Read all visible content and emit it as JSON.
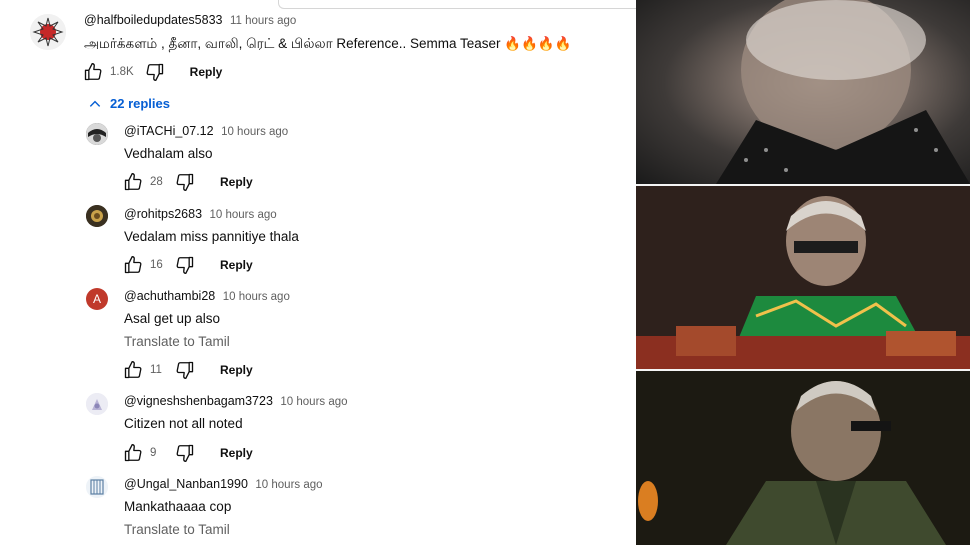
{
  "main_comment": {
    "author": "@halfboiledupdates5833",
    "time": "11 hours ago",
    "text": "அமர்க்களம் , தீனா, வாலி, ரெட் & பில்லா Reference.. Semma Teaser 🔥🔥🔥🔥",
    "likes": "1.8K",
    "reply_label": "Reply"
  },
  "replies_toggle": {
    "label": "22 replies"
  },
  "replies": [
    {
      "author": "@iTACHi_07.12",
      "time": "10 hours ago",
      "text": "Vedhalam also",
      "likes": "28",
      "reply_label": "Reply",
      "translate": ""
    },
    {
      "author": "@rohitps2683",
      "time": "10 hours ago",
      "text": "Vedalam miss pannitiye thala",
      "likes": "16",
      "reply_label": "Reply",
      "translate": ""
    },
    {
      "author": "@achuthambi28",
      "time": "10 hours ago",
      "text": "Asal get up also",
      "likes": "11",
      "reply_label": "Reply",
      "translate": "Translate to Tamil",
      "avatar_letter": "A"
    },
    {
      "author": "@vigneshshenbagam3723",
      "time": "10 hours ago",
      "text": "Citizen not all noted",
      "likes": "9",
      "reply_label": "Reply",
      "translate": ""
    },
    {
      "author": "@Ungal_Nanban1990",
      "time": "10 hours ago",
      "text": "Mankathaaaa cop",
      "likes": "",
      "reply_label": "",
      "translate": "Translate to Tamil"
    }
  ],
  "colors": {
    "link_blue": "#065fd4",
    "avatar_red": "#c0392b",
    "secondary_text": "#606060"
  }
}
